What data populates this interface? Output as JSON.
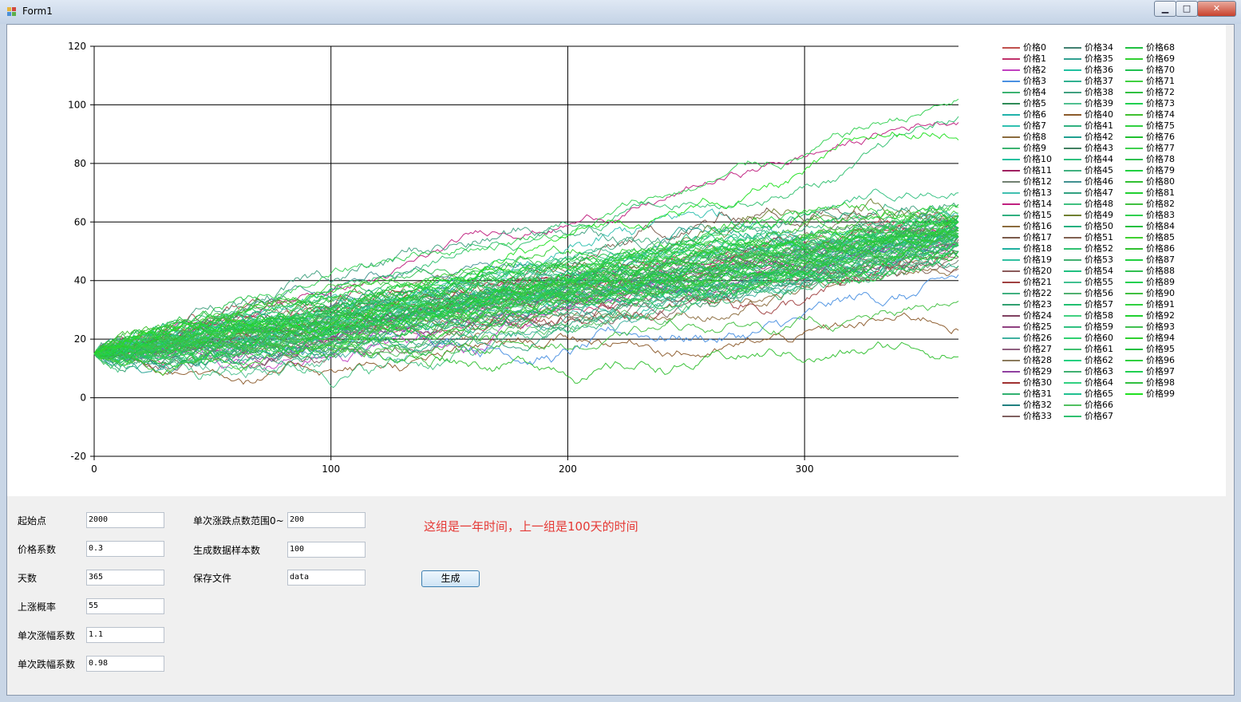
{
  "window": {
    "title": "Form1",
    "minimize": "▁",
    "maximize": "□",
    "close": "✕"
  },
  "chart_data": {
    "type": "line",
    "x_range": [
      0,
      365
    ],
    "ylim": [
      -20,
      120
    ],
    "x_ticks": [
      "0",
      "100",
      "200",
      "300"
    ],
    "y_ticks": [
      "120",
      "100",
      "80",
      "60",
      "40",
      "20",
      "0",
      "-20"
    ],
    "grid": true,
    "legend_position": "right",
    "series_count": 100,
    "series_start": 15,
    "series_final_values": [
      60,
      55,
      57,
      42,
      60,
      50,
      58,
      62,
      45,
      55,
      56,
      52,
      47,
      58,
      94,
      60,
      52,
      54,
      55,
      52,
      44,
      50,
      60,
      66,
      48,
      55,
      52,
      58,
      57,
      53,
      60,
      55,
      57,
      48,
      62,
      52,
      58,
      55,
      60,
      50,
      23,
      62,
      55,
      58,
      70,
      52,
      60,
      55,
      57,
      62,
      45,
      48,
      58,
      55,
      60,
      52,
      57,
      62,
      55,
      50,
      60,
      53,
      58,
      56,
      62,
      55,
      52,
      96,
      58,
      60,
      55,
      63,
      57,
      52,
      60,
      58,
      50,
      65,
      55,
      60,
      14,
      48,
      55,
      102,
      62,
      57,
      60,
      55,
      58,
      52,
      33,
      66,
      60,
      55,
      62,
      58,
      56,
      60,
      55,
      88
    ],
    "series_colors": [
      "#c0504d",
      "#c0306a",
      "#c040c0",
      "#4a90e2",
      "#3cb371",
      "#2e8b57",
      "#20b2aa",
      "#30c0b0",
      "#8b6b3d",
      "#3cb371",
      "#20c0a0",
      "#a02060",
      "#708070",
      "#40c0b0",
      "#c02080",
      "#30b080",
      "#8b6b3d",
      "#7a5a4a",
      "#20b0a0",
      "#30c0a0",
      "#8b5a5a",
      "#a04040",
      "#40b080",
      "#30a070",
      "#804060",
      "#904080",
      "#40b0a0",
      "#906080",
      "#8b7b5d",
      "#9040a0",
      "#a03030",
      "#30b070",
      "#208080",
      "#806060",
      "#408070",
      "#30a090",
      "#20c0a0",
      "#30b090",
      "#40a080",
      "#50c090",
      "#8b5a2a",
      "#30b080",
      "#20a090",
      "#408060",
      "#30c080",
      "#40b080",
      "#409090",
      "#30a080",
      "#40c080",
      "#708030",
      "#20b080",
      "#806050",
      "#30c070",
      "#40b070",
      "#20c080",
      "#40c090",
      "#50b070",
      "#20c070",
      "#40d080",
      "#30c080",
      "#30d070",
      "#40c070",
      "#20d080",
      "#40b070",
      "#30d080",
      "#20c090",
      "#50c060",
      "#30c070",
      "#20c040",
      "#30d030",
      "#20c050",
      "#40d040",
      "#30c040",
      "#20d050",
      "#40c030",
      "#30d040",
      "#20c030",
      "#40d050",
      "#30c050",
      "#20d040",
      "#30c030",
      "#20d030",
      "#40c040",
      "#30d050",
      "#20c040",
      "#40d030",
      "#30c030",
      "#20d040",
      "#30c050",
      "#20d050",
      "#40c040",
      "#30d040",
      "#20d030",
      "#40c050",
      "#30d030",
      "#20c040",
      "#30d040",
      "#20d050",
      "#30c040",
      "#20e020"
    ],
    "series": [
      {
        "name": "价格0"
      },
      {
        "name": "价格1"
      },
      {
        "name": "价格2"
      },
      {
        "name": "价格3"
      },
      {
        "name": "价格4"
      },
      {
        "name": "价格5"
      },
      {
        "name": "价格6"
      },
      {
        "name": "价格7"
      },
      {
        "name": "价格8"
      },
      {
        "name": "价格9"
      },
      {
        "name": "价格10"
      },
      {
        "name": "价格11"
      },
      {
        "name": "价格12"
      },
      {
        "name": "价格13"
      },
      {
        "name": "价格14"
      },
      {
        "name": "价格15"
      },
      {
        "name": "价格16"
      },
      {
        "name": "价格17"
      },
      {
        "name": "价格18"
      },
      {
        "name": "价格19"
      },
      {
        "name": "价格20"
      },
      {
        "name": "价格21"
      },
      {
        "name": "价格22"
      },
      {
        "name": "价格23"
      },
      {
        "name": "价格24"
      },
      {
        "name": "价格25"
      },
      {
        "name": "价格26"
      },
      {
        "name": "价格27"
      },
      {
        "name": "价格28"
      },
      {
        "name": "价格29"
      },
      {
        "name": "价格30"
      },
      {
        "name": "价格31"
      },
      {
        "name": "价格32"
      },
      {
        "name": "价格33"
      },
      {
        "name": "价格34"
      },
      {
        "name": "价格35"
      },
      {
        "name": "价格36"
      },
      {
        "name": "价格37"
      },
      {
        "name": "价格38"
      },
      {
        "name": "价格39"
      },
      {
        "name": "价格40"
      },
      {
        "name": "价格41"
      },
      {
        "name": "价格42"
      },
      {
        "name": "价格43"
      },
      {
        "name": "价格44"
      },
      {
        "name": "价格45"
      },
      {
        "name": "价格46"
      },
      {
        "name": "价格47"
      },
      {
        "name": "价格48"
      },
      {
        "name": "价格49"
      },
      {
        "name": "价格50"
      },
      {
        "name": "价格51"
      },
      {
        "name": "价格52"
      },
      {
        "name": "价格53"
      },
      {
        "name": "价格54"
      },
      {
        "name": "价格55"
      },
      {
        "name": "价格56"
      },
      {
        "name": "价格57"
      },
      {
        "name": "价格58"
      },
      {
        "name": "价格59"
      },
      {
        "name": "价格60"
      },
      {
        "name": "价格61"
      },
      {
        "name": "价格62"
      },
      {
        "name": "价格63"
      },
      {
        "name": "价格64"
      },
      {
        "name": "价格65"
      },
      {
        "name": "价格66"
      },
      {
        "name": "价格67"
      },
      {
        "name": "价格68"
      },
      {
        "name": "价格69"
      },
      {
        "name": "价格70"
      },
      {
        "name": "价格71"
      },
      {
        "name": "价格72"
      },
      {
        "name": "价格73"
      },
      {
        "name": "价格74"
      },
      {
        "name": "价格75"
      },
      {
        "name": "价格76"
      },
      {
        "name": "价格77"
      },
      {
        "name": "价格78"
      },
      {
        "name": "价格79"
      },
      {
        "name": "价格80"
      },
      {
        "name": "价格81"
      },
      {
        "name": "价格82"
      },
      {
        "name": "价格83"
      },
      {
        "name": "价格84"
      },
      {
        "name": "价格85"
      },
      {
        "name": "价格86"
      },
      {
        "name": "价格87"
      },
      {
        "name": "价格88"
      },
      {
        "name": "价格89"
      },
      {
        "name": "价格90"
      },
      {
        "name": "价格91"
      },
      {
        "name": "价格92"
      },
      {
        "name": "价格93"
      },
      {
        "name": "价格94"
      },
      {
        "name": "价格95"
      },
      {
        "name": "价格96"
      },
      {
        "name": "价格97"
      },
      {
        "name": "价格98"
      },
      {
        "name": "价格99"
      }
    ]
  },
  "form": {
    "start_point_label": "起始点",
    "start_point_value": "2000",
    "price_coef_label": "价格系数",
    "price_coef_value": "0.3",
    "days_label": "天数",
    "days_value": "365",
    "rise_prob_label": "上涨概率",
    "rise_prob_value": "55",
    "rise_coef_label": "单次涨幅系数",
    "rise_coef_value": "1.1",
    "fall_coef_label": "单次跌幅系数",
    "fall_coef_value": "0.98",
    "range_label": "单次涨跌点数范围0~",
    "range_value": "200",
    "samples_label": "生成数据样本数",
    "samples_value": "100",
    "save_label": "保存文件",
    "save_value": "data",
    "note": "这组是一年时间，上一组是100天的时间",
    "generate_button": "生成"
  },
  "colors": {
    "note": "#e53935",
    "client_bg": "#f0f0f0"
  }
}
